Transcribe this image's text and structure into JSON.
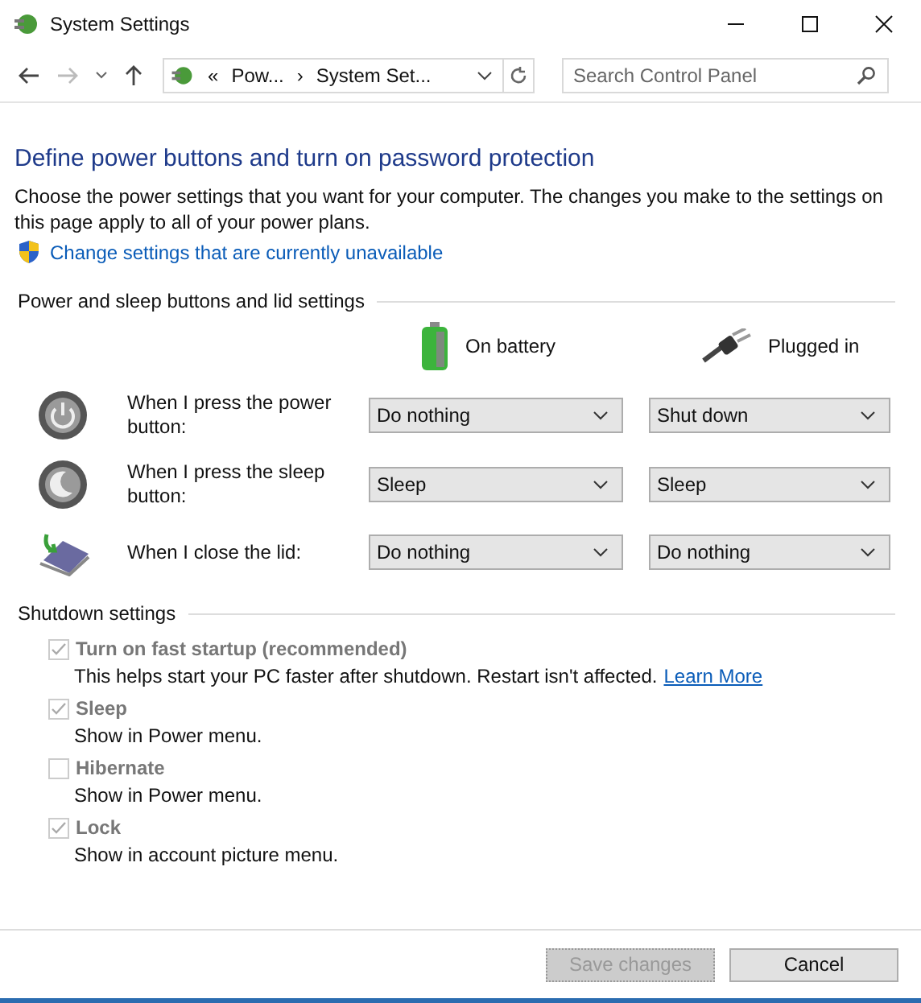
{
  "window": {
    "title": "System Settings"
  },
  "nav": {
    "breadcrumb": [
      {
        "label": "«"
      },
      {
        "label": "Pow..."
      },
      {
        "label": "›"
      },
      {
        "label": "System Set..."
      }
    ],
    "search": {
      "placeholder": "Search Control Panel"
    }
  },
  "heading": "Define power buttons and turn on password protection",
  "intro": "Choose the power settings that you want for your computer. The changes you make to the settings on this page apply to all of your power plans.",
  "admin_link": "Change settings that are currently unavailable",
  "buttons_section": {
    "title": "Power and sleep buttons and lid settings",
    "columns": [
      {
        "kind": "battery",
        "label": "On battery"
      },
      {
        "kind": "plug",
        "label": "Plugged in"
      }
    ],
    "rows": [
      {
        "kind": "power",
        "label": "When I press the power button:",
        "battery": "Do nothing",
        "plugged": "Shut down"
      },
      {
        "kind": "sleep",
        "label": "When I press the sleep button:",
        "battery": "Sleep",
        "plugged": "Sleep"
      },
      {
        "kind": "lid",
        "label": "When I close the lid:",
        "battery": "Do nothing",
        "plugged": "Do nothing"
      }
    ]
  },
  "shutdown_section": {
    "title": "Shutdown settings",
    "items": [
      {
        "label": "Turn on fast startup (recommended)",
        "checked": true,
        "disabled": true,
        "description": "This helps start your PC faster after shutdown. Restart isn't affected.",
        "link": "Learn More"
      },
      {
        "label": "Sleep",
        "checked": true,
        "disabled": true,
        "description": "Show in Power menu."
      },
      {
        "label": "Hibernate",
        "checked": false,
        "disabled": true,
        "description": "Show in Power menu."
      },
      {
        "label": "Lock",
        "checked": true,
        "disabled": true,
        "description": "Show in account picture menu."
      }
    ]
  },
  "footer": {
    "save": {
      "label": "Save changes",
      "disabled": true
    },
    "cancel": {
      "label": "Cancel"
    }
  }
}
